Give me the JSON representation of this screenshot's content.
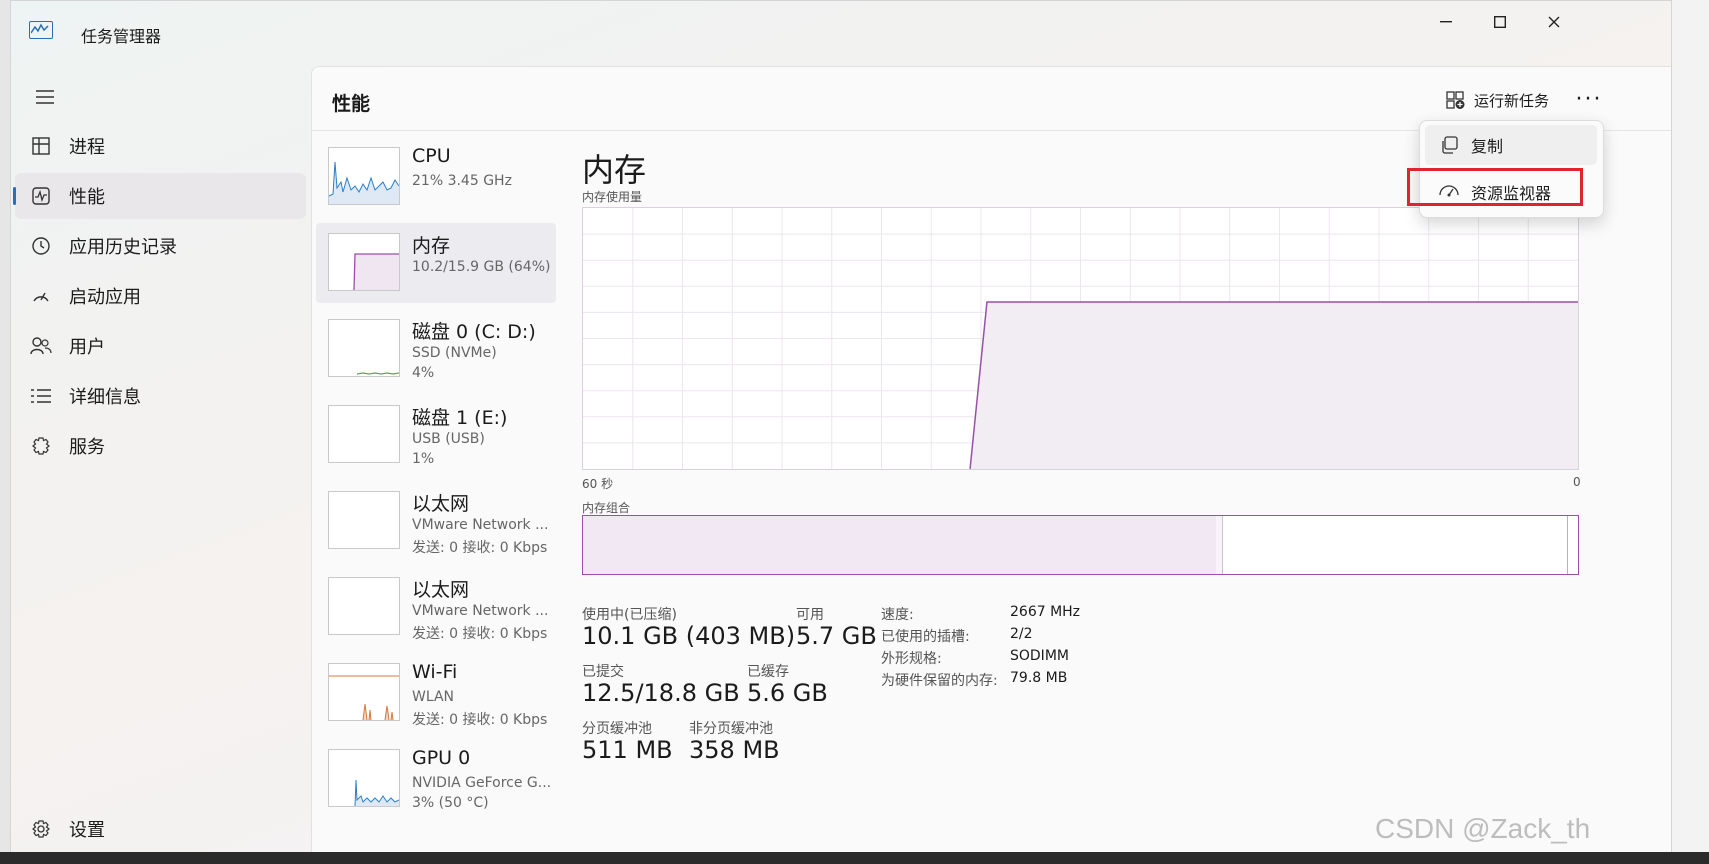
{
  "window": {
    "title": "任务管理器"
  },
  "sidebar": {
    "items": [
      {
        "label": "进程",
        "icon": "processes-icon"
      },
      {
        "label": "性能",
        "icon": "performance-icon",
        "active": true
      },
      {
        "label": "应用历史记录",
        "icon": "history-icon"
      },
      {
        "label": "启动应用",
        "icon": "startup-icon"
      },
      {
        "label": "用户",
        "icon": "users-icon"
      },
      {
        "label": "详细信息",
        "icon": "details-icon"
      },
      {
        "label": "服务",
        "icon": "services-icon"
      }
    ],
    "settings_label": "设置"
  },
  "header": {
    "page_title": "性能",
    "run_task_label": "运行新任务"
  },
  "menu": {
    "items": [
      {
        "label": "复制",
        "icon": "copy-icon"
      },
      {
        "label": "资源监视器",
        "icon": "resource-monitor-icon"
      }
    ]
  },
  "devices": [
    {
      "name": "CPU",
      "sub1": "21% 3.45 GHz",
      "sub2": ""
    },
    {
      "name": "内存",
      "sub1": "10.2/15.9 GB (64%)",
      "sub2": "",
      "selected": true
    },
    {
      "name": "磁盘 0 (C: D:)",
      "sub1": "SSD (NVMe)",
      "sub2": "4%"
    },
    {
      "name": "磁盘 1 (E:)",
      "sub1": "USB (USB)",
      "sub2": "1%"
    },
    {
      "name": "以太网",
      "sub1": "VMware Network ...",
      "sub2": "发送: 0 接收: 0 Kbps"
    },
    {
      "name": "以太网",
      "sub1": "VMware Network ...",
      "sub2": "发送: 0 接收: 0 Kbps"
    },
    {
      "name": "Wi-Fi",
      "sub1": "WLAN",
      "sub2": "发送: 0 接收: 0 Kbps"
    },
    {
      "name": "GPU 0",
      "sub1": "NVIDIA GeForce G...",
      "sub2": "3% (50 °C)"
    }
  ],
  "memory": {
    "title": "内存",
    "usage_label": "内存使用量",
    "axis_left": "60 秒",
    "axis_right": "0",
    "composition_label": "内存组合",
    "composition_in_use_fraction": 0.636,
    "composition_modified_fraction": 0.006,
    "usage_history_fraction_after_step": 0.64,
    "stats": {
      "in_use_label": "使用中(已压缩)",
      "in_use_value": "10.1 GB (403 MB)",
      "available_label": "可用",
      "available_value": "5.7 GB",
      "committed_label": "已提交",
      "committed_value": "12.5/18.8 GB",
      "cached_label": "已缓存",
      "cached_value": "5.6 GB",
      "paged_label": "分页缓冲池",
      "paged_value": "511 MB",
      "nonpaged_label": "非分页缓冲池",
      "nonpaged_value": "358 MB"
    },
    "details": {
      "speed_label": "速度:",
      "speed_value": "2667 MHz",
      "slots_label": "已使用的插槽:",
      "slots_value": "2/2",
      "form_label": "外形规格:",
      "form_value": "SODIMM",
      "reserved_label": "为硬件保留的内存:",
      "reserved_value": "79.8 MB"
    }
  },
  "watermark": "CSDN @Zack_th",
  "colors": {
    "accent": "#2a6fb5",
    "memory": "#9a4fa8",
    "highlight": "#e0242b"
  }
}
